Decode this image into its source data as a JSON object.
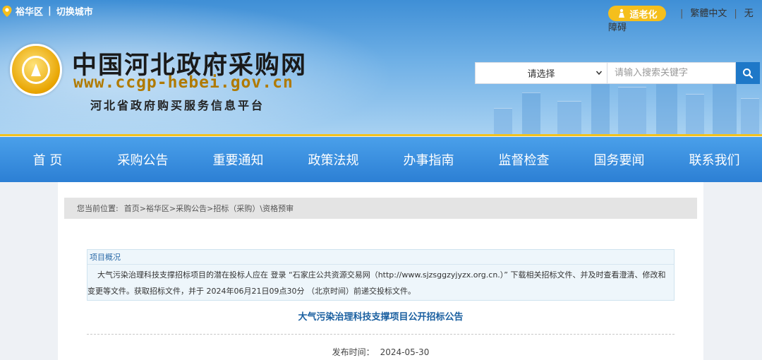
{
  "location": {
    "district": "裕华区",
    "switch_label": "切换城市",
    "separator": "|"
  },
  "top_bar": {
    "elder_mode": "适老化",
    "traditional": "繁體中文",
    "accessible": "无障碍",
    "separator": "|"
  },
  "header": {
    "title": "中国河北政府采购网",
    "url": "www.ccgp-hebei.gov.cn",
    "subtitle": "河北省政府购买服务信息平台"
  },
  "search": {
    "select_value": "请选择",
    "placeholder": "请输入搜索关键字"
  },
  "nav": {
    "items": [
      "首 页",
      "采购公告",
      "重要通知",
      "政策法规",
      "办事指南",
      "监督检查",
      "国务要闻",
      "联系我们"
    ]
  },
  "breadcrumb": {
    "label": "您当前位置:",
    "items": [
      "首页",
      "裕华区",
      "采购公告",
      "招标（采购）\\资格预审"
    ],
    "separator": ">"
  },
  "overview": {
    "title": "项目概况",
    "body": "大气污染治理科技支撑招标项目的潜在投标人应在 登录 “石家庄公共资源交易网（http://www.sjzsggzyjyzx.org.cn.）” 下载相关招标文件、并及时查看澄清、修改和变更等文件。获取招标文件，并于 2024年06月21日09点30分 （北京时间）前递交投标文件。"
  },
  "notice": {
    "title": "大气污染治理科技支撑项目公开招标公告",
    "publish_label": "发布时间：",
    "publish_date": "2024-05-30"
  },
  "colors": {
    "nav": "#2c7fd4",
    "accent_gold": "#f2c21d",
    "search_button": "#1e78c8",
    "notice_title": "#1a5fa0"
  }
}
